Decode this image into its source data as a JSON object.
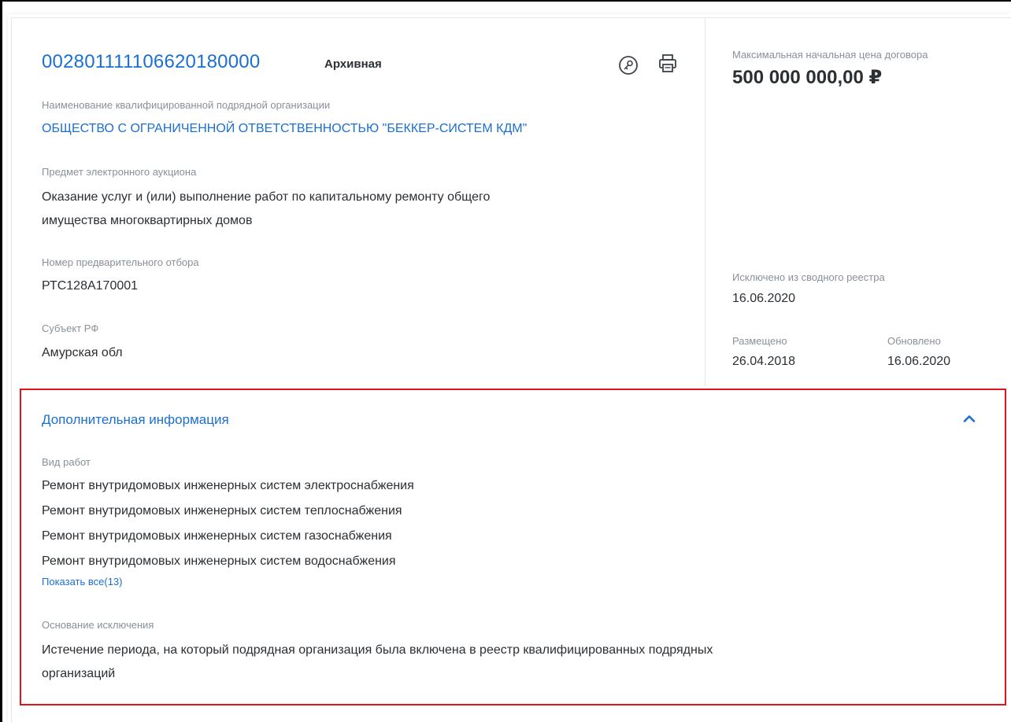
{
  "header": {
    "lot_number": "002801111106620180000",
    "status": "Архивная",
    "key_icon": "key-icon",
    "print_icon": "printer-icon"
  },
  "organization": {
    "label": "Наименование квалифицированной подрядной организации",
    "value": "ОБЩЕСТВО С ОГРАНИЧЕННОЙ ОТВЕТСТВЕННОСТЬЮ \"БЕККЕР-СИСТЕМ КДМ\""
  },
  "subject": {
    "label": "Предмет электронного аукциона",
    "line1": "Оказание услуг и (или) выполнение работ по капитальному ремонту общего",
    "line2": "имущества многоквартирных домов"
  },
  "preselection": {
    "label": "Номер предварительного отбора",
    "value": "РТС128А170001"
  },
  "region": {
    "label": "Субъект РФ",
    "value": "Амурская обл"
  },
  "side": {
    "price_label": "Максимальная начальная цена договора",
    "price": "500 000 000,00 ₽",
    "excluded_label": "Исключено из сводного реестра",
    "excluded_date": "16.06.2020",
    "placed_label": "Размещено",
    "placed_date": "26.04.2018",
    "updated_label": "Обновлено",
    "updated_date": "16.06.2020"
  },
  "additional": {
    "title": "Дополнительная информация",
    "chevron_icon": "chevron-up-icon",
    "works_label": "Вид работ",
    "works": [
      "Ремонт внутридомовых инженерных систем электроснабжения",
      "Ремонт внутридомовых инженерных систем теплоснабжения",
      "Ремонт внутридомовых инженерных систем газоснабжения",
      "Ремонт внутридомовых инженерных систем водоснабжения"
    ],
    "show_all": "Показать все(13)",
    "reason_label": "Основание исключения",
    "reason_line1": "Истечение периода, на который подрядная организация была включена в реестр квалифицированных подрядных",
    "reason_line2": "организаций"
  },
  "colors": {
    "accent": "#1b6fd3",
    "highlight": "#e0141e",
    "muted": "#8a9098",
    "text": "#2b2f33"
  }
}
